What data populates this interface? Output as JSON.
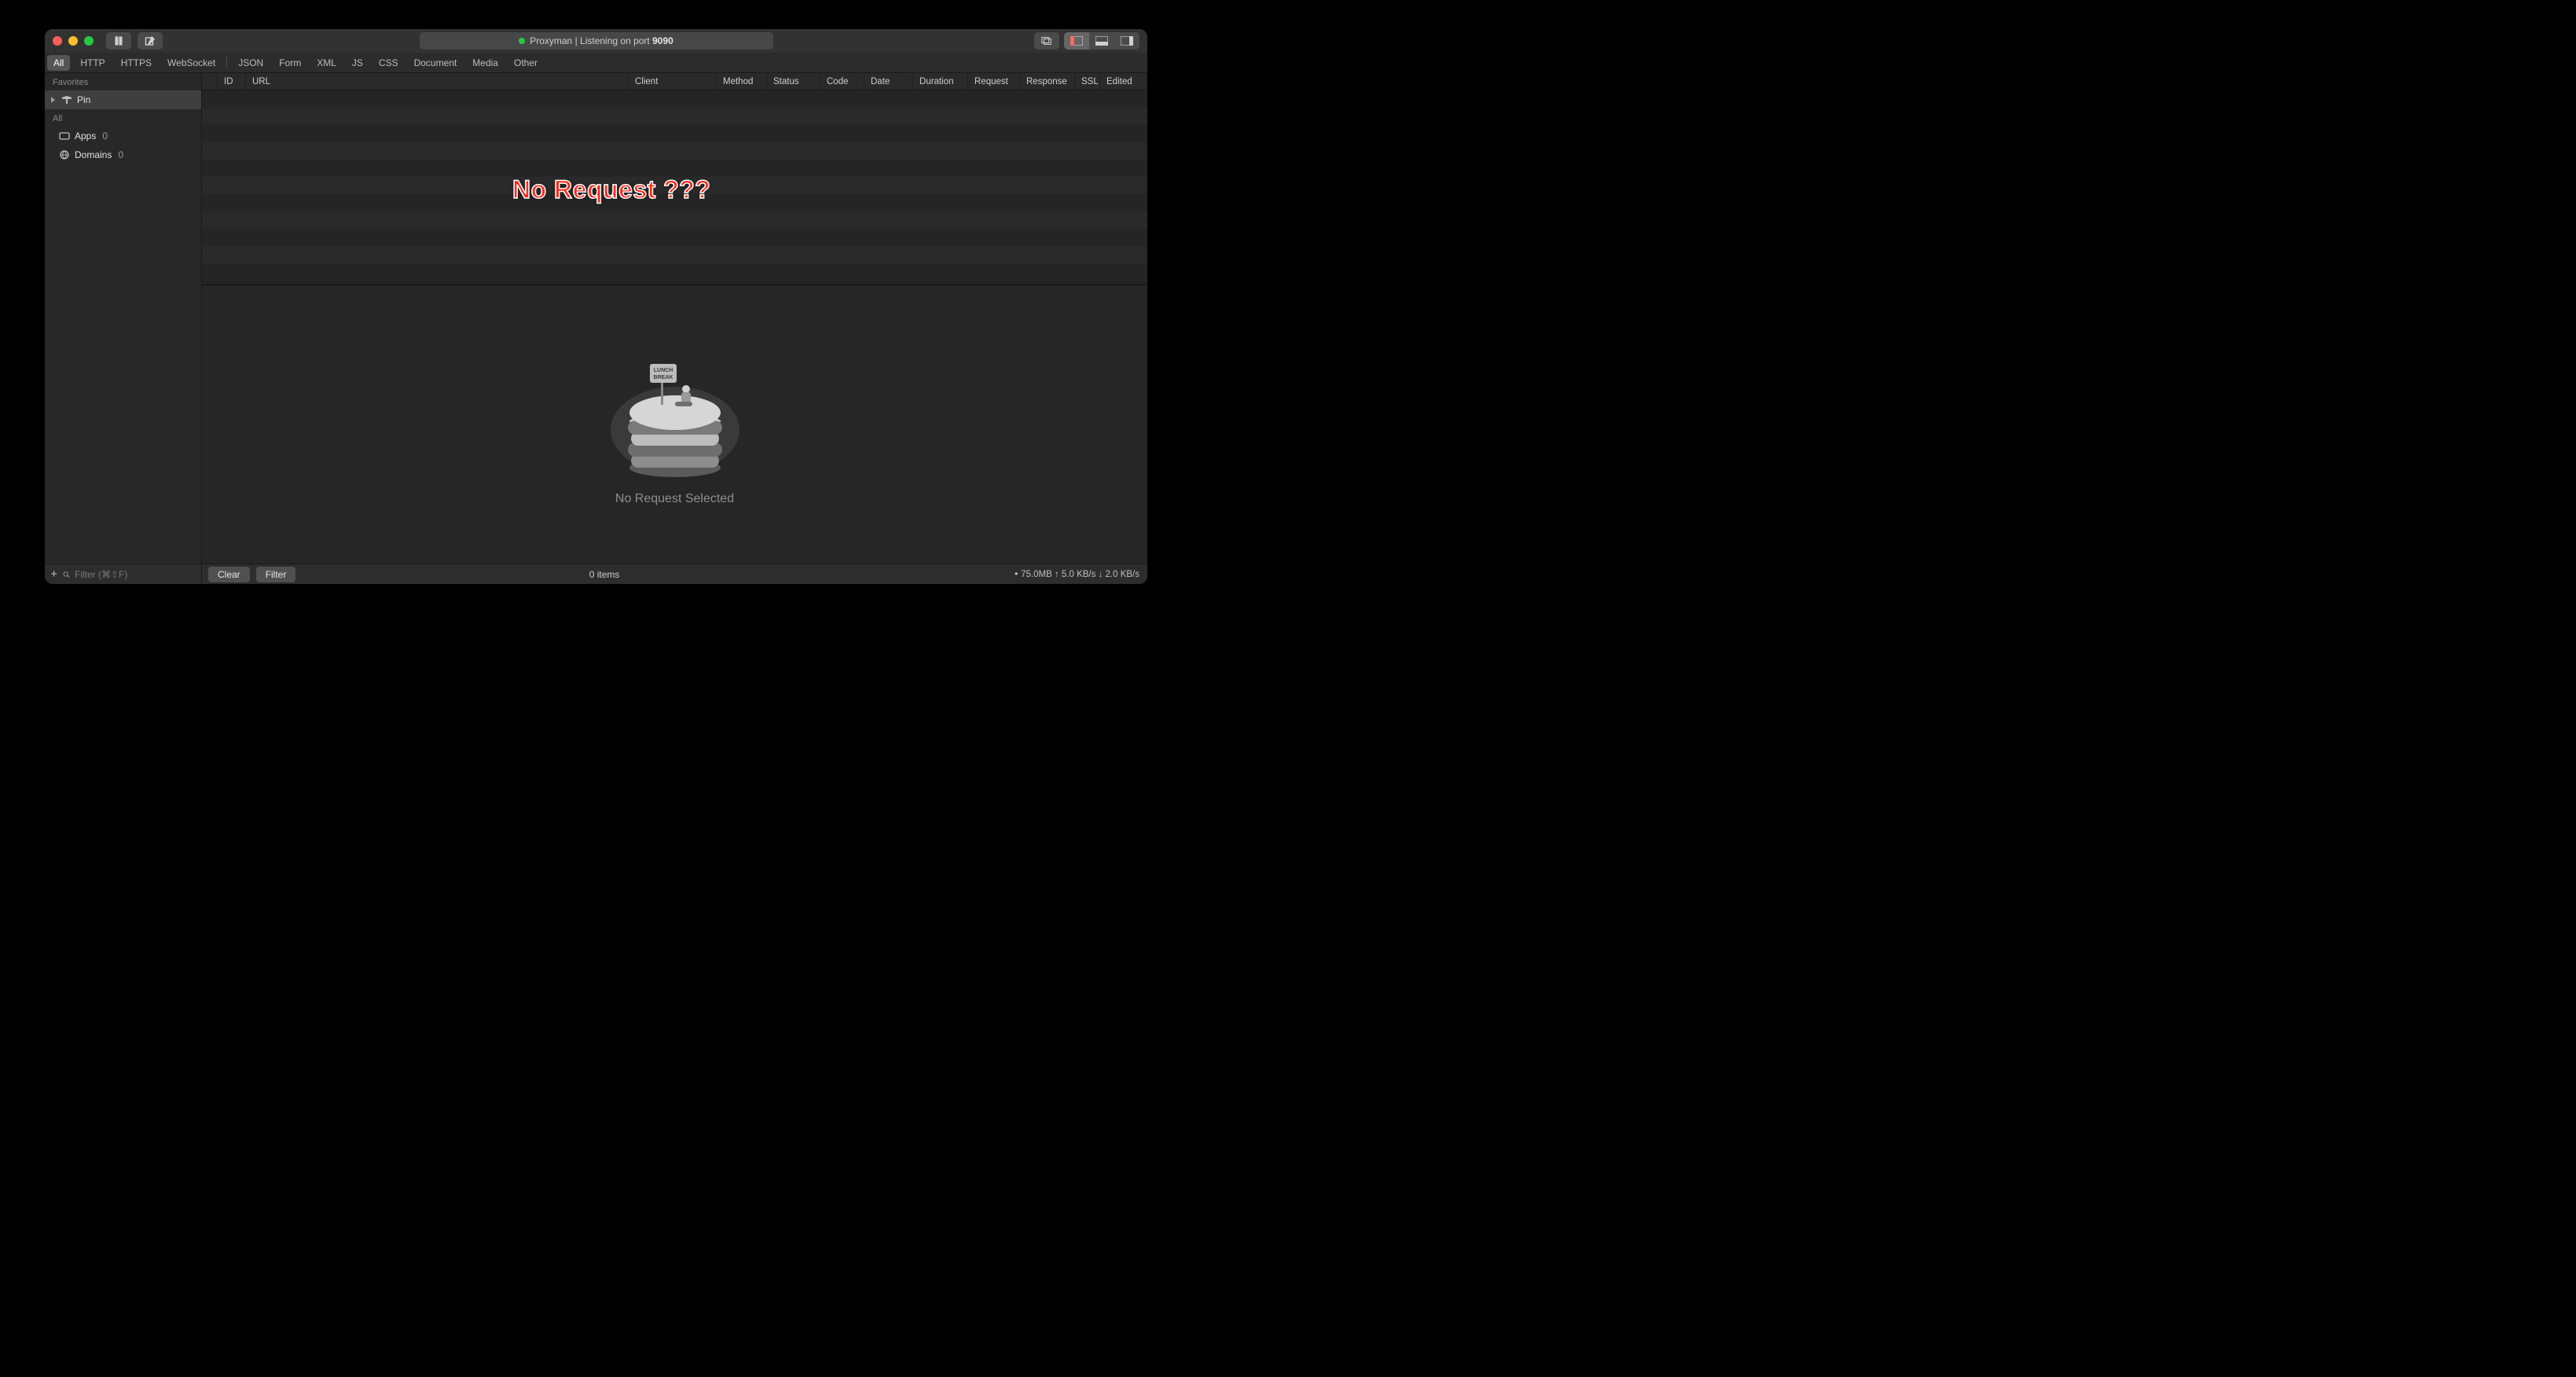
{
  "title": {
    "app": "Proxyman",
    "sep": " | ",
    "listening_prefix": "Listening on port ",
    "port": "9090"
  },
  "filter_tabs_left": [
    "All",
    "HTTP",
    "HTTPS",
    "WebSocket"
  ],
  "filter_tabs_right": [
    "JSON",
    "Form",
    "XML",
    "JS",
    "CSS",
    "Document",
    "Media",
    "Other"
  ],
  "filter_active": "All",
  "table_columns": [
    "ID",
    "URL",
    "Client",
    "Method",
    "Status",
    "Code",
    "Date",
    "Duration",
    "Request",
    "Response",
    "SSL",
    "Edited"
  ],
  "sidebar": {
    "favorites_header": "Favorites",
    "pin_label": "Pin",
    "all_header": "All",
    "apps": {
      "label": "Apps",
      "count": "0"
    },
    "domains": {
      "label": "Domains",
      "count": "0"
    }
  },
  "annotation": "No Request ???",
  "detail": {
    "message": "No Request Selected",
    "sign_line1": "LUNCH",
    "sign_line2": "BREAK"
  },
  "footer": {
    "filter_placeholder": "Filter (⌘⇧F)",
    "clear": "Clear",
    "filter": "Filter",
    "items": "0 items",
    "mem": "75.0MB",
    "up": "5.0 KB/s",
    "down": "2.0 KB/s"
  }
}
